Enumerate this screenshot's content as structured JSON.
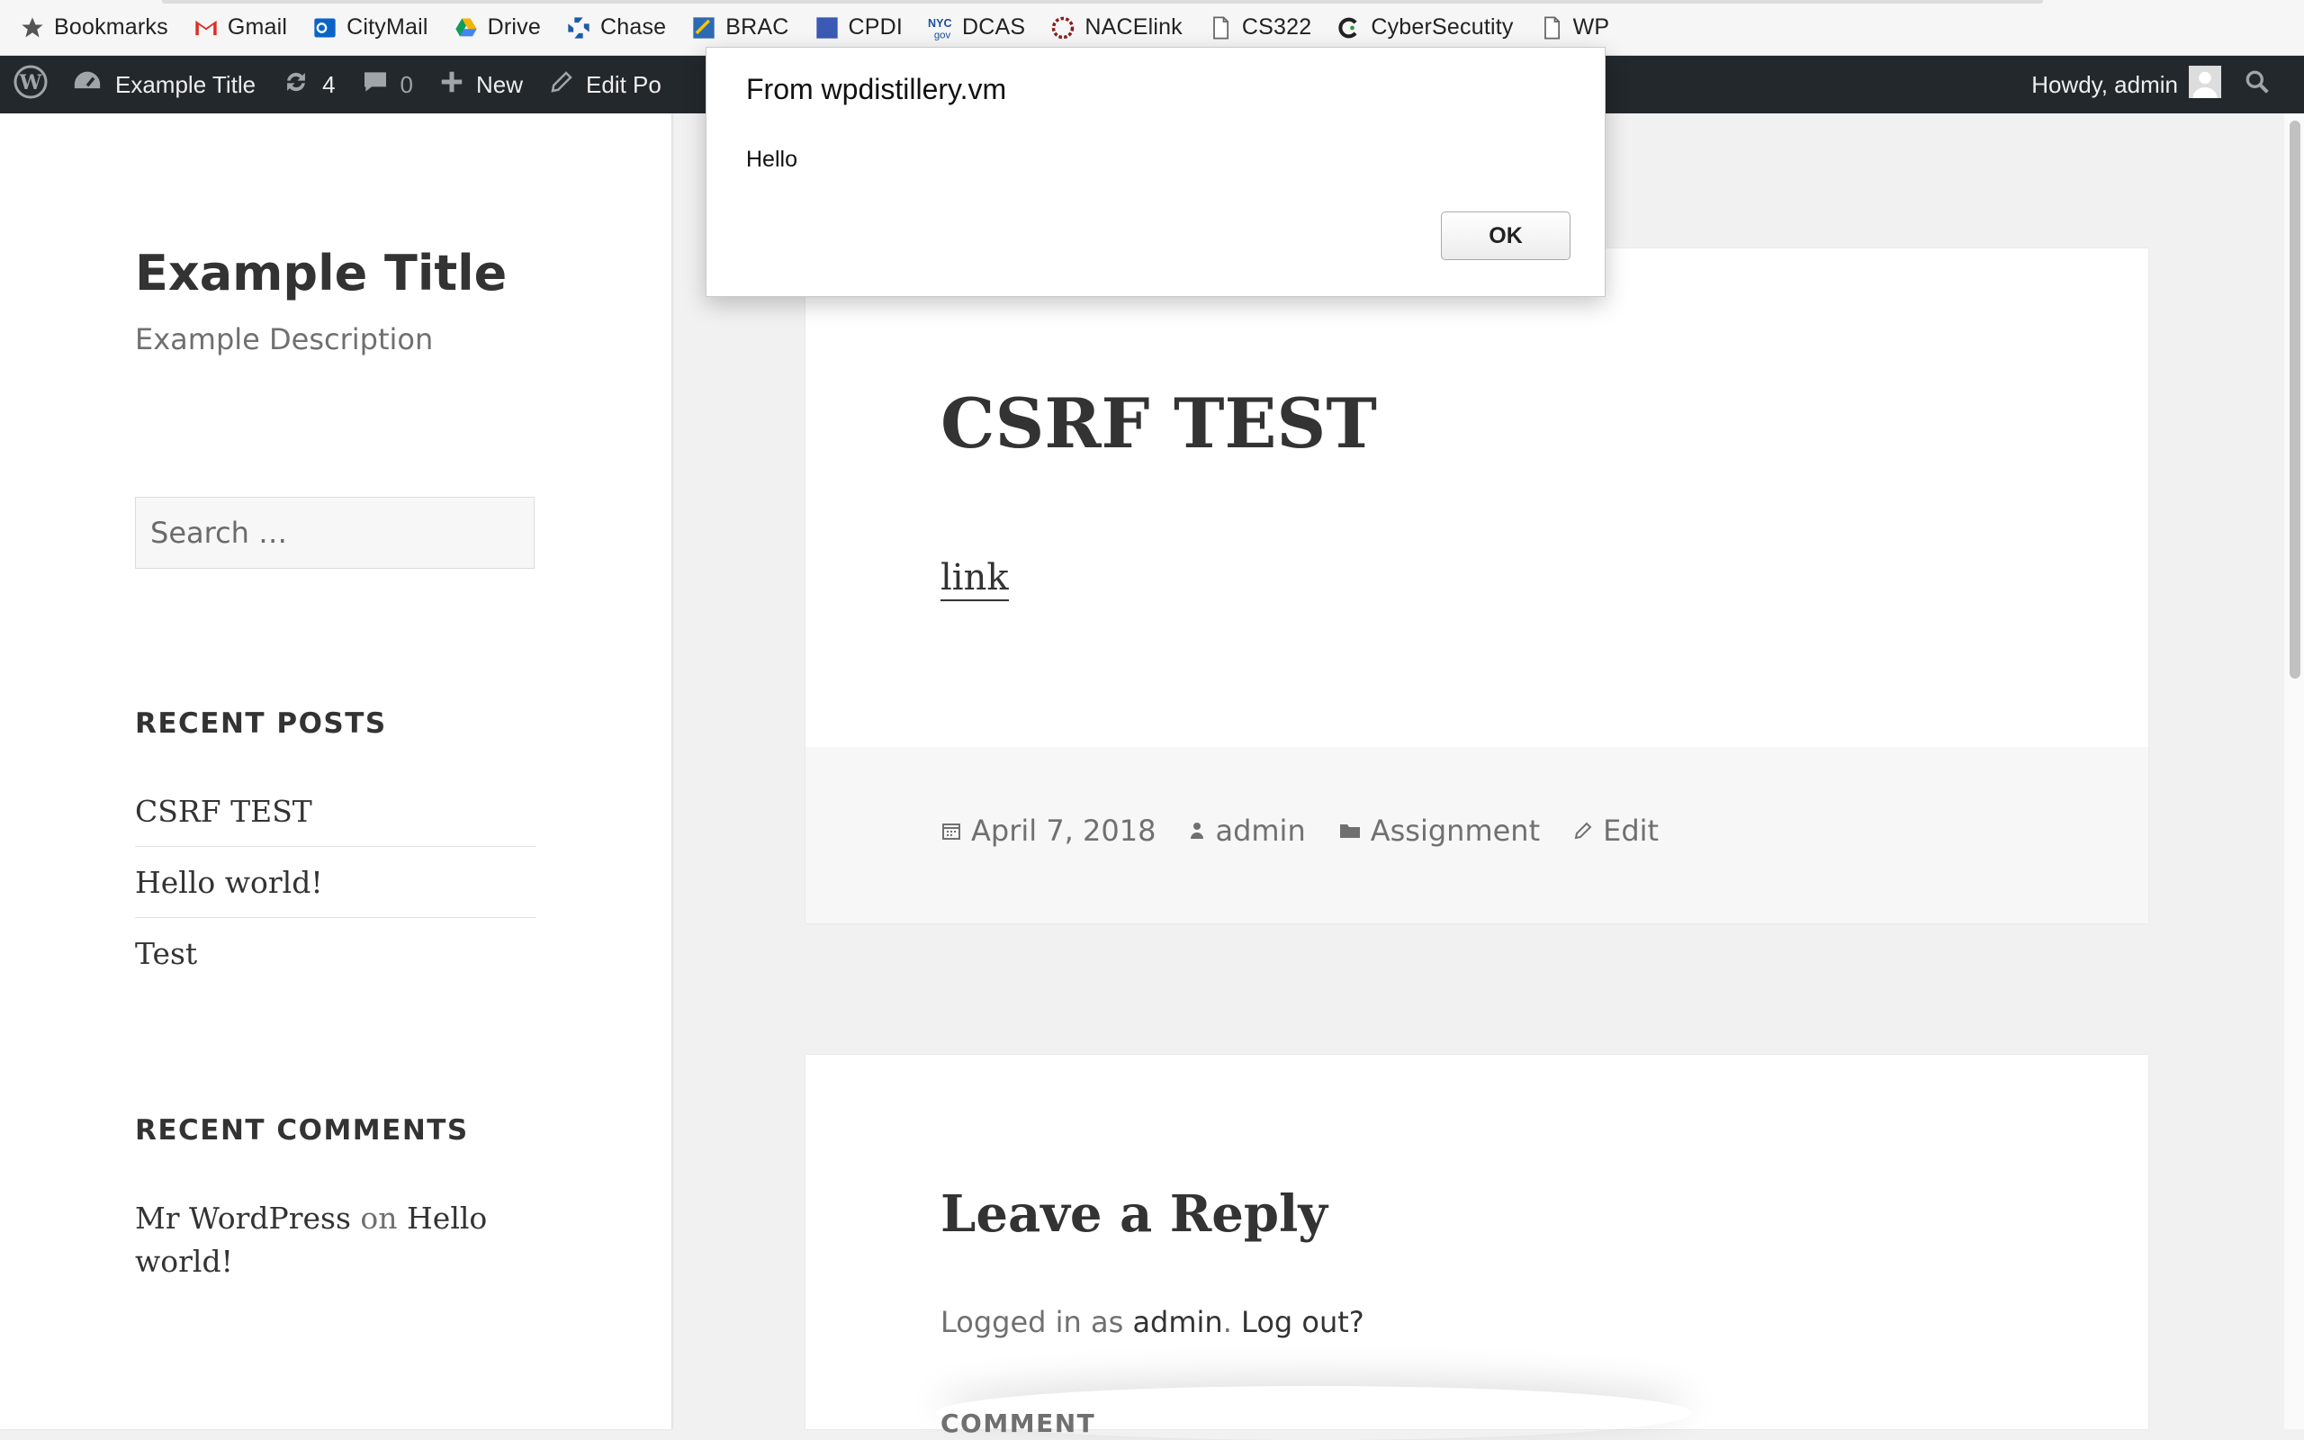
{
  "bookmarks": [
    {
      "label": "Bookmarks",
      "icon": "star-icon"
    },
    {
      "label": "Gmail",
      "icon": "gmail-icon"
    },
    {
      "label": "CityMail",
      "icon": "outlook-icon"
    },
    {
      "label": "Drive",
      "icon": "drive-icon"
    },
    {
      "label": "Chase",
      "icon": "chase-icon"
    },
    {
      "label": "BRAC",
      "icon": "brac-icon"
    },
    {
      "label": "CPDI",
      "icon": "cpdi-icon"
    },
    {
      "label": "DCAS",
      "icon": "nyc-gov-icon"
    },
    {
      "label": "NACElink",
      "icon": "nacelink-icon"
    },
    {
      "label": "CS322",
      "icon": "page-icon"
    },
    {
      "label": "CyberSecutity",
      "icon": "cybersecurity-icon"
    },
    {
      "label": "WP",
      "icon": "page-icon"
    }
  ],
  "adminbar": {
    "site_name": "Example Title",
    "updates_count": "4",
    "comments_count": "0",
    "new_label": "New",
    "edit_label": "Edit Po",
    "howdy": "Howdy, admin"
  },
  "sidebar": {
    "site_title": "Example Title",
    "site_description": "Example Description",
    "search_placeholder": "Search …",
    "recent_posts_heading": "RECENT POSTS",
    "recent_posts": [
      "CSRF TEST",
      "Hello world!",
      "Test"
    ],
    "recent_comments_heading": "RECENT COMMENTS",
    "comment": {
      "author": "Mr WordPress",
      "on": "on",
      "post": "Hello world!"
    }
  },
  "post": {
    "title": "CSRF TEST",
    "link_text": "link",
    "date": "April 7, 2018",
    "author": "admin",
    "category": "Assignment",
    "edit": "Edit"
  },
  "reply": {
    "title": "Leave a Reply",
    "logged_in_prefix": "Logged in as",
    "user": "admin",
    "separator": ".",
    "logout": "Log out?",
    "comment_label": "COMMENT"
  },
  "dialog": {
    "title": "From wpdistillery.vm",
    "message": "Hello",
    "ok_label": "OK"
  },
  "colors": {
    "adminbar_bg": "#23282d",
    "sidebar_bg": "#ffffff",
    "page_bg": "#f1f1f1",
    "text": "#333333",
    "muted": "#707070"
  }
}
